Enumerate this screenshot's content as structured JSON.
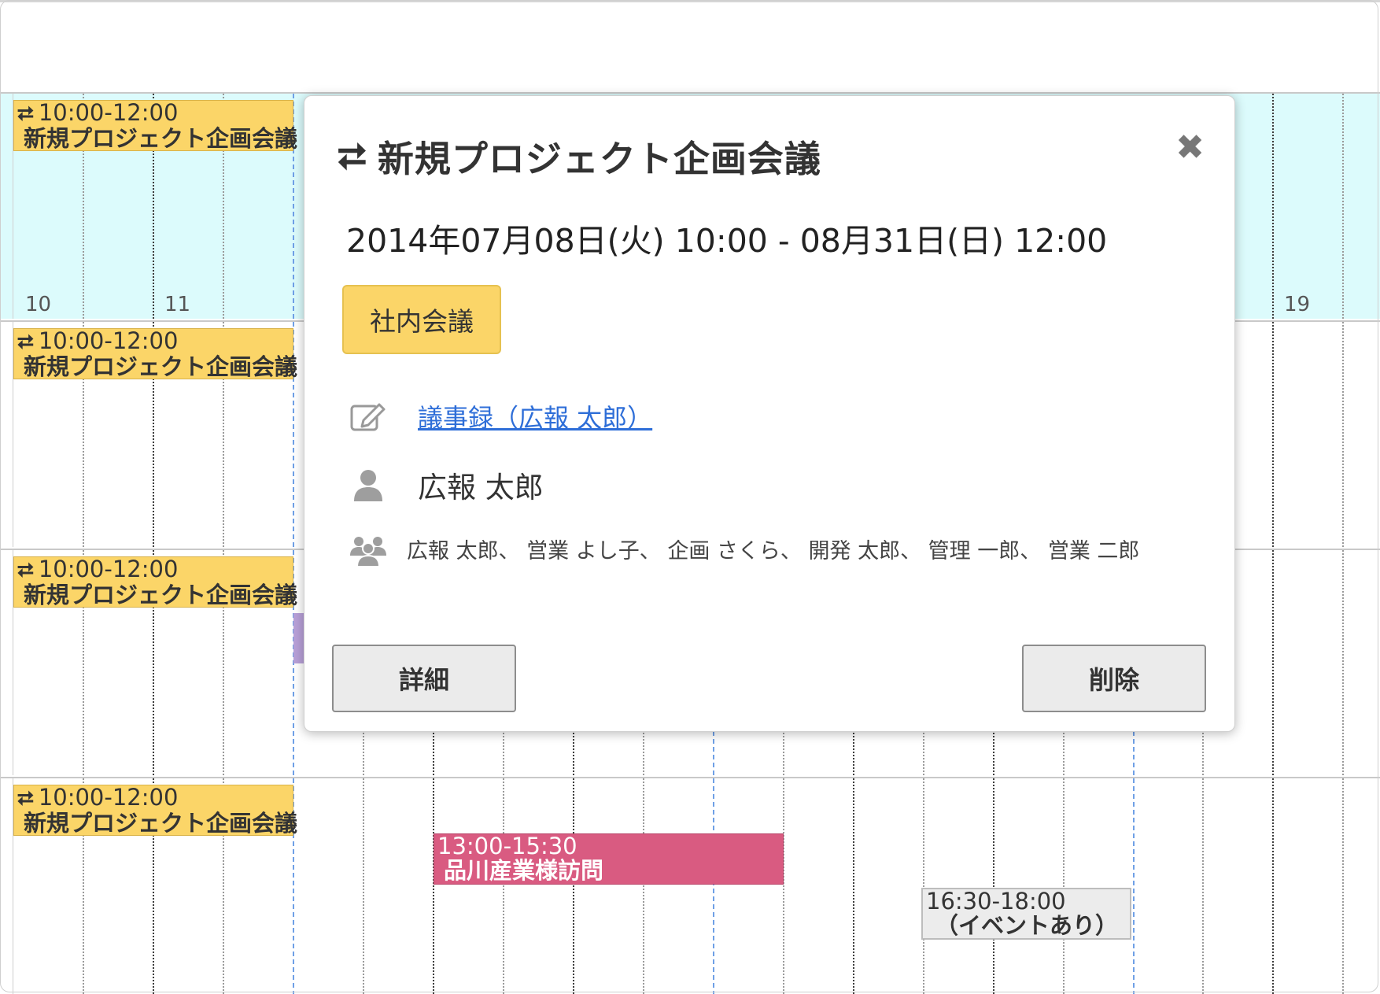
{
  "hours": {
    "h10": "10",
    "h11": "11",
    "h19": "19"
  },
  "recurring_event": {
    "time": "10:00-12:00",
    "title": "新規プロジェクト企画会議",
    "repeat_icon": "repeat-icon",
    "color": "#fbd568"
  },
  "other_events": {
    "visit": {
      "time": "13:00-15:30",
      "title": "品川産業様訪問",
      "color": "#d95b81"
    },
    "event": {
      "time": "16:30-18:00",
      "title": "（イベントあり）",
      "color": "#ececec"
    }
  },
  "popup": {
    "title": "新規プロジェクト企画会議",
    "datetime": "2014年07月08日(火) 10:00 - 08月31日(日) 12:00",
    "category": "社内会議",
    "minutes_link": "議事録（広報 太郎）",
    "owner": "広報 太郎",
    "members": "広報 太郎、 営業 よし子、 企画 さくら、 開発 太郎、 管理 一郎、 営業 二郎",
    "detail_button": "詳細",
    "delete_button": "削除",
    "close_icon": "close-icon"
  }
}
